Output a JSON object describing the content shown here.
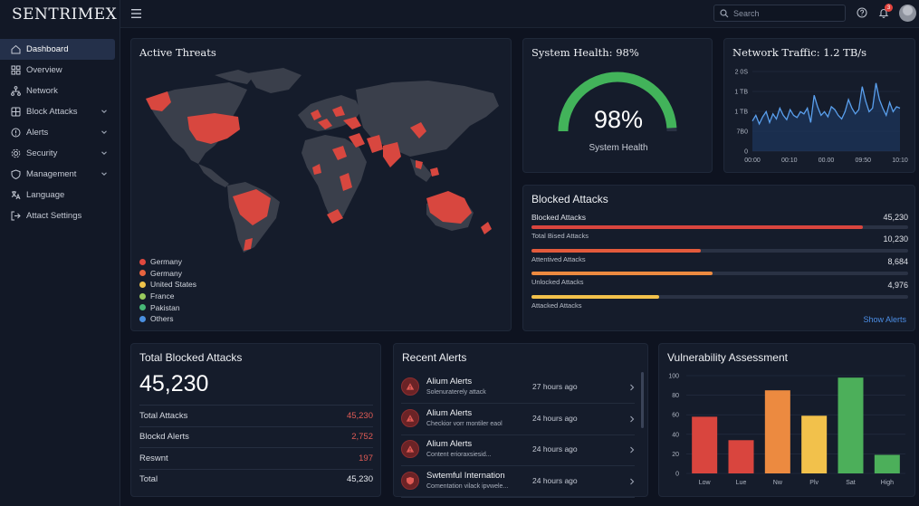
{
  "app": {
    "brand": "SENTRIMEX"
  },
  "sidebar": {
    "items": [
      {
        "label": "Dashboard",
        "icon": "home-icon",
        "active": true,
        "chevron": false
      },
      {
        "label": "Overview",
        "icon": "grid-icon",
        "active": false,
        "chevron": false
      },
      {
        "label": "Network",
        "icon": "network-icon",
        "active": false,
        "chevron": false
      },
      {
        "label": "Block Attacks",
        "icon": "block-icon",
        "active": false,
        "chevron": true
      },
      {
        "label": "Alerts",
        "icon": "alert-icon",
        "active": false,
        "chevron": true
      },
      {
        "label": "Security",
        "icon": "gear-icon",
        "active": false,
        "chevron": true
      },
      {
        "label": "Management",
        "icon": "shield-icon",
        "active": false,
        "chevron": true
      },
      {
        "label": "Language",
        "icon": "language-icon",
        "active": false,
        "chevron": false
      },
      {
        "label": "Attact Settings",
        "icon": "logout-icon",
        "active": false,
        "chevron": false
      }
    ]
  },
  "topbar": {
    "search_placeholder": "Search",
    "notification_count": "3"
  },
  "threats": {
    "title": "Active Threats",
    "legend": [
      {
        "label": "Germany",
        "color": "#e0483e"
      },
      {
        "label": "Germany",
        "color": "#e8643f"
      },
      {
        "label": "United States",
        "color": "#efc34a"
      },
      {
        "label": "France",
        "color": "#9acb5e"
      },
      {
        "label": "Pakistan",
        "color": "#47b877"
      },
      {
        "label": "Others",
        "color": "#4a8fe0"
      }
    ]
  },
  "health": {
    "title": "System Health: 98%",
    "value": "98%",
    "label": "System Health",
    "percent": 98
  },
  "traffic": {
    "title": "Network Traffic: 1.2 TB/s",
    "y_ticks": [
      "2 0S",
      "1 TB",
      "1 TB",
      "7B0",
      "0"
    ],
    "x_ticks": [
      "00:00",
      "00:10",
      "00.00",
      "09:50",
      "10:10"
    ]
  },
  "blocked": {
    "title": "Blocked Attacks",
    "rows": [
      {
        "label": "Blocked Attacks",
        "value": "45,230",
        "sub": "Total Bised Attacks",
        "color": "#d9453e",
        "fraction": 0.88
      },
      {
        "label": "",
        "value": "10,230",
        "sub": "Attentived Attacks",
        "color": "#e35a3c",
        "fraction": 0.45
      },
      {
        "label": "",
        "value": "8,684",
        "sub": "Unlocked Attacks",
        "color": "#ec8a40",
        "fraction": 0.48
      },
      {
        "label": "",
        "value": "4,976",
        "sub": "Attacked Attacks",
        "color": "#f2c14b",
        "fraction": 0.34
      }
    ],
    "link": "Show Alerts"
  },
  "totals": {
    "title": "Total Blocked Attacks",
    "big": "45,230",
    "rows": [
      {
        "label": "Total Attacks",
        "value": "45,230"
      },
      {
        "label": "Blockd Alerts",
        "value": "2,752"
      },
      {
        "label": "Reswnt",
        "value": "197"
      },
      {
        "label": "Total",
        "value": "45,230"
      }
    ]
  },
  "alerts": {
    "title": "Recent Alerts",
    "items": [
      {
        "title": "Alium Alerts",
        "sub": "Solenuraterely attack",
        "time": "27 hours ago",
        "icon": "warning-icon"
      },
      {
        "title": "Alium Alerts",
        "sub": "Checkior vorr montiler eaol",
        "time": "24 hours ago",
        "icon": "warning-icon"
      },
      {
        "title": "Alium Alerts",
        "sub": "Content erioraxsiesid...",
        "time": "24 hours ago",
        "icon": "warning-icon"
      },
      {
        "title": "Swtemful Internation",
        "sub": "Comentation vilack ipvwele...",
        "time": "24 hours ago",
        "icon": "shield-icon"
      }
    ]
  },
  "vulnerability": {
    "title": "Vulnerability Assessment"
  },
  "chart_data": {
    "type": "bar",
    "categories": [
      "Low",
      "Lue",
      "Nw",
      "Plv",
      "Sat",
      "High"
    ],
    "values": [
      58,
      34,
      85,
      59,
      98,
      19
    ],
    "colors": [
      "#d9453e",
      "#d9453e",
      "#ec8a40",
      "#f2c14b",
      "#4caf5a",
      "#4caf5a"
    ],
    "y_ticks": [
      0,
      20,
      40,
      60,
      80,
      100
    ],
    "ylim": [
      0,
      100
    ],
    "title": "Vulnerability Assessment",
    "xlabel": "",
    "ylabel": "",
    "grid": true
  }
}
